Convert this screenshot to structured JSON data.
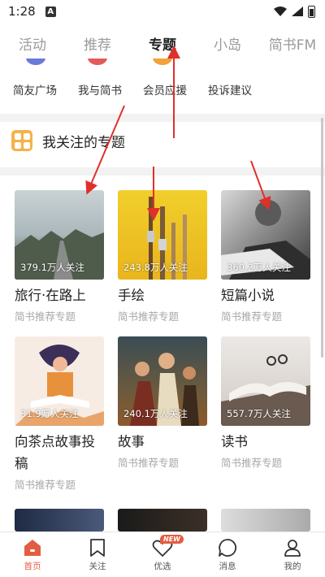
{
  "status_bar": {
    "time": "1:28",
    "notification_letter": "A"
  },
  "top_tabs": [
    {
      "label": "活动",
      "active": false
    },
    {
      "label": "推荐",
      "active": false
    },
    {
      "label": "专题",
      "active": true
    },
    {
      "label": "小岛",
      "active": false
    },
    {
      "label": "简书FM",
      "active": false
    }
  ],
  "quick_links": [
    "简友广场",
    "我与简书",
    "会员应援",
    "投诉建议"
  ],
  "section": {
    "title": "我关注的专题"
  },
  "topics": [
    {
      "title": "旅行·在路上",
      "followers": "379.1万人关注",
      "subtitle": "简书推荐专题"
    },
    {
      "title": "手绘",
      "followers": "243.8万人关注",
      "subtitle": "简书推荐专题"
    },
    {
      "title": "短篇小说",
      "followers": "360.2万人关注",
      "subtitle": "简书推荐专题"
    },
    {
      "title": "向茶点故事投稿",
      "followers": "31.9万人关注",
      "subtitle": "简书推荐专题"
    },
    {
      "title": "故事",
      "followers": "240.1万人关注",
      "subtitle": "简书推荐专题"
    },
    {
      "title": "读书",
      "followers": "557.7万人关注",
      "subtitle": "简书推荐专题"
    }
  ],
  "bottom_nav": [
    {
      "label": "首页",
      "icon": "home-icon",
      "active": true
    },
    {
      "label": "关注",
      "icon": "bookmark-icon",
      "active": false
    },
    {
      "label": "优选",
      "icon": "heart-icon",
      "active": false,
      "badge": "NEW"
    },
    {
      "label": "消息",
      "icon": "message-icon",
      "active": false
    },
    {
      "label": "我的",
      "icon": "profile-icon",
      "active": false
    }
  ],
  "colors": {
    "accent": "#e35d42",
    "section_icon": "#f5b24a",
    "annotation_arrow": "#e0302a"
  }
}
